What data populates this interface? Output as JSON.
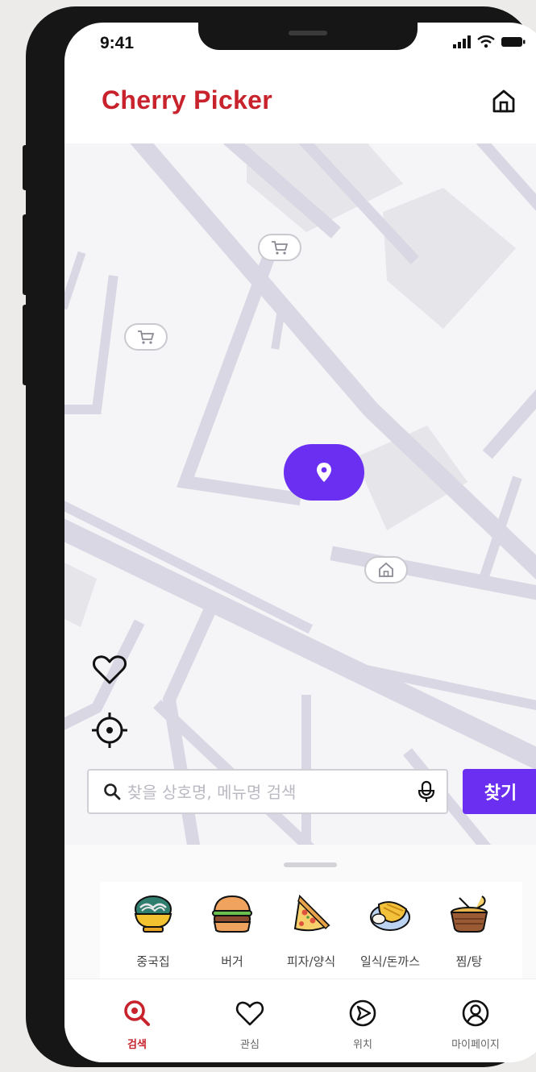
{
  "status_bar": {
    "time": "9:41"
  },
  "header": {
    "title": "Cherry Picker"
  },
  "search": {
    "placeholder": "찾을 상호명, 메뉴명 검색",
    "value": "",
    "submit_label": "찾기"
  },
  "categories": [
    {
      "label": "중국집",
      "icon": "noodle-bowl-icon"
    },
    {
      "label": "버거",
      "icon": "burger-icon"
    },
    {
      "label": "피자/양식",
      "icon": "pizza-icon"
    },
    {
      "label": "일식/돈까스",
      "icon": "cutlet-icon"
    },
    {
      "label": "찜/탕",
      "icon": "stew-pot-icon"
    }
  ],
  "tabs": [
    {
      "label": "검색",
      "icon": "search-icon",
      "active": true
    },
    {
      "label": "관심",
      "icon": "heart-icon",
      "active": false
    },
    {
      "label": "위치",
      "icon": "navigation-icon",
      "active": false
    },
    {
      "label": "마이페이지",
      "icon": "profile-icon",
      "active": false
    }
  ],
  "colors": {
    "brand": "#c8232c",
    "accent": "#6a2ff0",
    "road": "#d8d7e3",
    "map_bg": "#f5f5f8"
  }
}
